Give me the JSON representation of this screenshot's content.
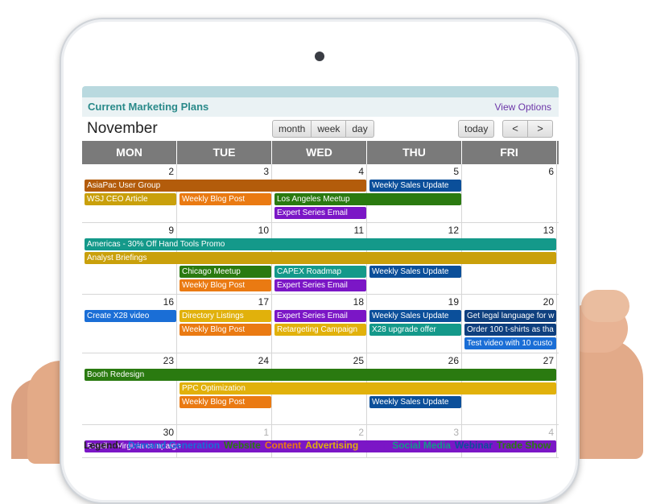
{
  "header": {
    "title": "Current Marketing Plans",
    "view_options": "View Options"
  },
  "toolbar": {
    "month": "November",
    "view_month": "month",
    "view_week": "week",
    "view_day": "day",
    "today": "today",
    "prev": "<",
    "next": ">"
  },
  "weekdays": [
    "MON",
    "TUE",
    "WED",
    "THU",
    "FRI"
  ],
  "colors": {
    "brown": "#b35c0b",
    "gold": "#c9a00b",
    "orange": "#ea7a12",
    "green": "#2a7a10",
    "purple": "#7b16c6",
    "navy": "#0b4f9a",
    "teal": "#14998a",
    "olive": "#c9a00b",
    "blue": "#1a6ed6",
    "darknavy": "#0e3f7e",
    "mustard": "#e1b10b"
  },
  "weeks": [
    {
      "days": [
        "2",
        "3",
        "4",
        "5",
        "6"
      ],
      "other": [
        false,
        false,
        false,
        false,
        false
      ],
      "events": [
        {
          "label": "AsiaPac User Group",
          "col": 0,
          "span": 3,
          "lane": 0,
          "color": "#b35c0b"
        },
        {
          "label": "Weekly Sales Update",
          "col": 3,
          "span": 1,
          "lane": 0,
          "color": "#0b4f9a"
        },
        {
          "label": "WSJ CEO Article",
          "col": 0,
          "span": 1,
          "lane": 1,
          "color": "#c9a00b"
        },
        {
          "label": "Weekly Blog Post",
          "col": 1,
          "span": 1,
          "lane": 1,
          "color": "#ea7a12"
        },
        {
          "label": "Los Angeles Meetup",
          "col": 2,
          "span": 2,
          "lane": 1,
          "color": "#2a7a10"
        },
        {
          "label": "Expert Series Email",
          "col": 2,
          "span": 1,
          "lane": 2,
          "color": "#7b16c6"
        }
      ]
    },
    {
      "days": [
        "9",
        "10",
        "11",
        "12",
        "13"
      ],
      "other": [
        false,
        false,
        false,
        false,
        false
      ],
      "events": [
        {
          "label": "Americas - 30% Off Hand Tools Promo",
          "col": 0,
          "span": 5,
          "lane": 0,
          "color": "#14998a"
        },
        {
          "label": "Analyst Briefings",
          "col": 0,
          "span": 5,
          "lane": 1,
          "color": "#c9a00b"
        },
        {
          "label": "Chicago Meetup",
          "col": 1,
          "span": 1,
          "lane": 2,
          "color": "#2a7a10"
        },
        {
          "label": "CAPEX Roadmap",
          "col": 2,
          "span": 1,
          "lane": 2,
          "color": "#14998a"
        },
        {
          "label": "Weekly Sales Update",
          "col": 3,
          "span": 1,
          "lane": 2,
          "color": "#0b4f9a"
        },
        {
          "label": "Weekly Blog Post",
          "col": 1,
          "span": 1,
          "lane": 3,
          "color": "#ea7a12"
        },
        {
          "label": "Expert Series Email",
          "col": 2,
          "span": 1,
          "lane": 3,
          "color": "#7b16c6"
        }
      ]
    },
    {
      "days": [
        "16",
        "17",
        "18",
        "19",
        "20"
      ],
      "other": [
        false,
        false,
        false,
        false,
        false
      ],
      "events": [
        {
          "label": "Create X28 video",
          "col": 0,
          "span": 1,
          "lane": 0,
          "color": "#1a6ed6"
        },
        {
          "label": "Directory Listings",
          "col": 1,
          "span": 1,
          "lane": 0,
          "color": "#e1b10b"
        },
        {
          "label": "Expert Series Email",
          "col": 2,
          "span": 1,
          "lane": 0,
          "color": "#7b16c6"
        },
        {
          "label": "Weekly Sales Update",
          "col": 3,
          "span": 1,
          "lane": 0,
          "color": "#0b4f9a"
        },
        {
          "label": "Get legal language for w",
          "col": 4,
          "span": 1,
          "lane": 0,
          "color": "#0e3f7e"
        },
        {
          "label": "Weekly Blog Post",
          "col": 1,
          "span": 1,
          "lane": 1,
          "color": "#ea7a12"
        },
        {
          "label": "Retargeting Campaign",
          "col": 2,
          "span": 1,
          "lane": 1,
          "color": "#e1b10b"
        },
        {
          "label": "X28 upgrade offer",
          "col": 3,
          "span": 1,
          "lane": 1,
          "color": "#14998a"
        },
        {
          "label": "Order 100 t-shirts as tha",
          "col": 4,
          "span": 1,
          "lane": 1,
          "color": "#0e3f7e"
        },
        {
          "label": "Test video with 10 custo",
          "col": 4,
          "span": 1,
          "lane": 2,
          "color": "#1a6ed6"
        }
      ]
    },
    {
      "days": [
        "23",
        "24",
        "25",
        "26",
        "27"
      ],
      "other": [
        false,
        false,
        false,
        false,
        false
      ],
      "events": [
        {
          "label": "Booth Redesign",
          "col": 0,
          "span": 5,
          "lane": 0,
          "color": "#2a7a10"
        },
        {
          "label": "PPC Optimization",
          "col": 1,
          "span": 4,
          "lane": 1,
          "color": "#e1b10b"
        },
        {
          "label": "Weekly Blog Post",
          "col": 1,
          "span": 1,
          "lane": 2,
          "color": "#ea7a12"
        },
        {
          "label": "Weekly Sales Update",
          "col": 3,
          "span": 1,
          "lane": 2,
          "color": "#0b4f9a"
        }
      ]
    },
    {
      "days": [
        "30",
        "1",
        "2",
        "3",
        "4"
      ],
      "other": [
        false,
        true,
        true,
        true,
        true
      ],
      "events": [
        {
          "label": "Email -- Virginia campaign",
          "col": 0,
          "span": 5,
          "lane": 0,
          "color": "#7b16c6"
        }
      ]
    }
  ],
  "legend": {
    "title": "Legend:",
    "items": [
      {
        "label": "Demand Generation",
        "color": "#1a6ed6"
      },
      {
        "label": "Website",
        "color": "#2a7a10"
      },
      {
        "label": "Content",
        "color": "#ea7a12"
      },
      {
        "label": "Advertising",
        "color": "#e1b10b"
      },
      {
        "label": "Email",
        "color": "#7b16c6"
      },
      {
        "label": "Social Media",
        "color": "#14998a"
      },
      {
        "label": "Webinar",
        "color": "#0b4f9a"
      },
      {
        "label": "Trade Show",
        "color": "#2a7a10"
      }
    ]
  }
}
